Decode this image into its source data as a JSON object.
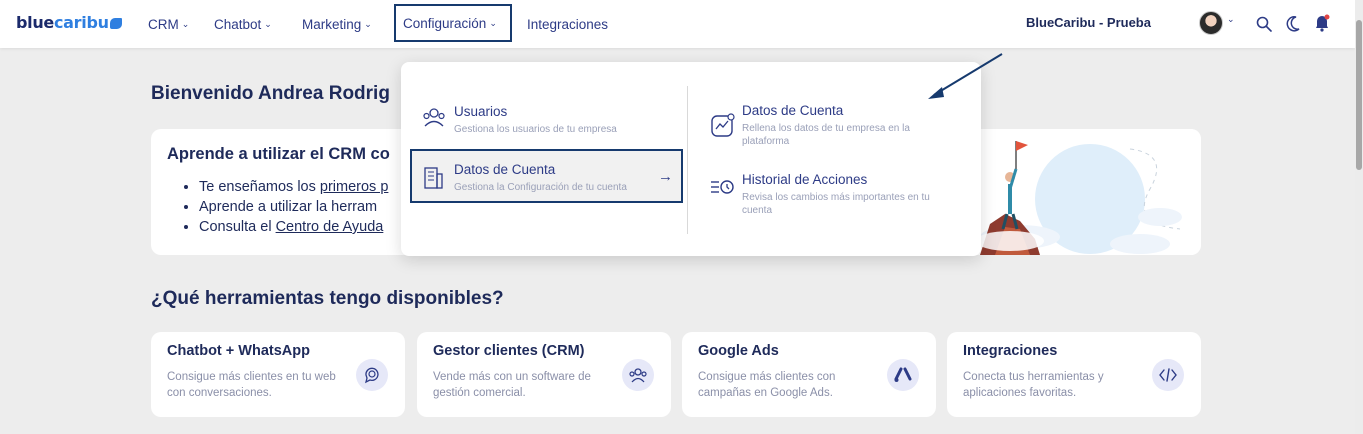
{
  "app": {
    "logo_part1": "blue",
    "logo_part2": "caribu",
    "account": "BlueCaribu - Prueba"
  },
  "nav": [
    {
      "label": "CRM"
    },
    {
      "label": "Chatbot"
    },
    {
      "label": "Marketing"
    },
    {
      "label": "Configuración"
    },
    {
      "label": "Integraciones"
    }
  ],
  "welcome": "Bienvenido Andrea Rodrig",
  "learn": {
    "title": "Aprende a utilizar el CRM co",
    "items": [
      {
        "prefix": "Te enseñamos los ",
        "link": "primeros p"
      },
      {
        "prefix": "Aprende a utilizar la herram",
        "link": ""
      },
      {
        "prefix": "Consulta el ",
        "link": "Centro de Ayuda"
      }
    ]
  },
  "tools_title": "¿Qué herramientas tengo disponibles?",
  "tools": [
    {
      "title": "Chatbot + WhatsApp",
      "desc": "Consigue más clientes en tu web con conversaciones.",
      "icon": "chat-icon"
    },
    {
      "title": "Gestor clientes (CRM)",
      "desc": "Vende más con un software de gestión comercial.",
      "icon": "users-icon"
    },
    {
      "title": "Google Ads",
      "desc": "Consigue más clientes con campañas en Google Ads.",
      "icon": "google-ads-icon"
    },
    {
      "title": "Integraciones",
      "desc": "Conecta tus herramientas y aplicaciones favoritas.",
      "icon": "code-icon"
    }
  ],
  "dropdown": {
    "left": [
      {
        "title": "Usuarios",
        "desc": "Gestiona los usuarios de tu empresa",
        "icon": "users-icon"
      },
      {
        "title": "Datos de Cuenta",
        "desc": "Gestiona la Configuración de tu cuenta",
        "icon": "building-icon"
      }
    ],
    "right": [
      {
        "title": "Datos de Cuenta",
        "desc": "Rellena los datos de tu empresa en la plataforma",
        "icon": "chart-growth-icon"
      },
      {
        "title": "Historial de Acciones",
        "desc": "Revisa los cambios más importantes en tu cuenta",
        "icon": "history-list-icon"
      }
    ]
  },
  "colors": {
    "accent": "#2d3b86",
    "highlight_border": "#163a6e",
    "notification": "#e04545"
  }
}
